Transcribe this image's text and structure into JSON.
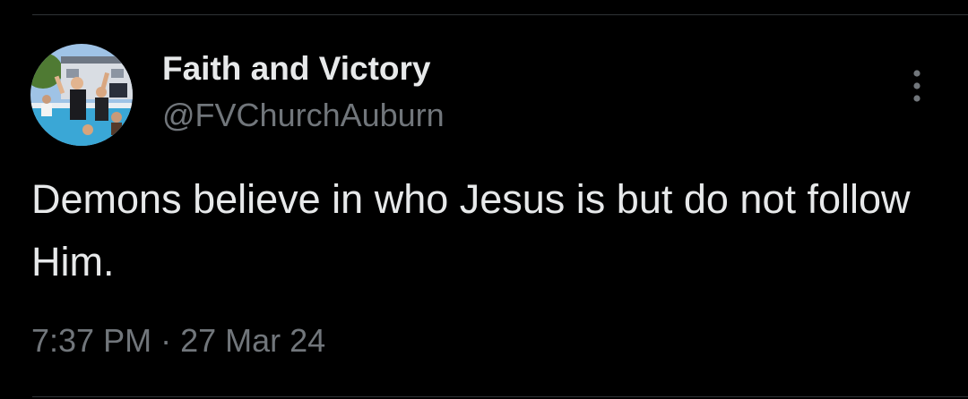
{
  "tweet": {
    "author": {
      "display_name": "Faith and Victory",
      "handle": "@FVChurchAuburn",
      "avatar_icon": "profile-photo-avatar"
    },
    "text": "Demons believe in who Jesus is but do not follow Him.",
    "time": "7:37 PM",
    "separator": "·",
    "date": "27 Mar 24",
    "more_icon": "more-options-icon"
  },
  "colors": {
    "background": "#000000",
    "primary_text": "#e7e9ea",
    "secondary_text": "#71767b",
    "divider": "#2f3336"
  }
}
